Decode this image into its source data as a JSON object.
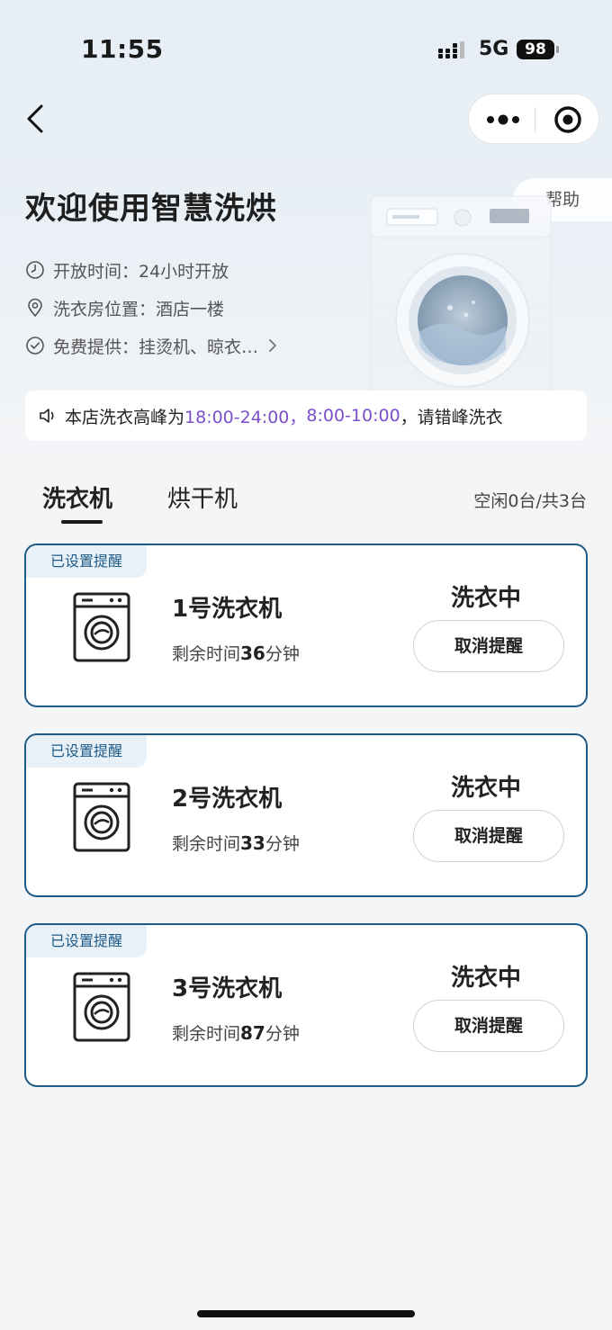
{
  "status_bar": {
    "time": "11:55",
    "network": "5G",
    "battery": "98"
  },
  "header": {
    "help_label": "帮助",
    "title": "欢迎使用智慧洗烘"
  },
  "info": {
    "hours": "开放时间：24小时开放",
    "location": "洗衣房位置：酒店一楼",
    "free": "免费提供：挂烫机、晾衣…"
  },
  "notice": {
    "prefix": "本店洗衣高峰为",
    "peak1": "18:00-24:00，",
    "peak2": "8:00-10:00",
    "suffix": "，请错峰洗衣"
  },
  "tabs": [
    {
      "label": "洗衣机",
      "active": true
    },
    {
      "label": "烘干机",
      "active": false
    }
  ],
  "idle_count": "空闲0台/共3台",
  "machines": [
    {
      "tag": "已设置提醒",
      "name": "1号洗衣机",
      "remaining_label": "剩余时间",
      "minutes": "36",
      "unit": "分钟",
      "status": "洗衣中",
      "button": "取消提醒"
    },
    {
      "tag": "已设置提醒",
      "name": "2号洗衣机",
      "remaining_label": "剩余时间",
      "minutes": "33",
      "unit": "分钟",
      "status": "洗衣中",
      "button": "取消提醒"
    },
    {
      "tag": "已设置提醒",
      "name": "3号洗衣机",
      "remaining_label": "剩余时间",
      "minutes": "87",
      "unit": "分钟",
      "status": "洗衣中",
      "button": "取消提醒"
    }
  ],
  "colors": {
    "accent": "#1e5a86",
    "peak_highlight": "#7b4fc9",
    "tag_bg": "#e8f1f8"
  },
  "icons": {
    "back": "chevron-left-icon",
    "more": "more-dots-icon",
    "target": "target-icon",
    "clock": "clock-icon",
    "location": "location-pin-icon",
    "check": "check-circle-icon",
    "arrow": "chevron-right-icon",
    "speaker": "speaker-icon",
    "machine": "washing-machine-icon"
  }
}
